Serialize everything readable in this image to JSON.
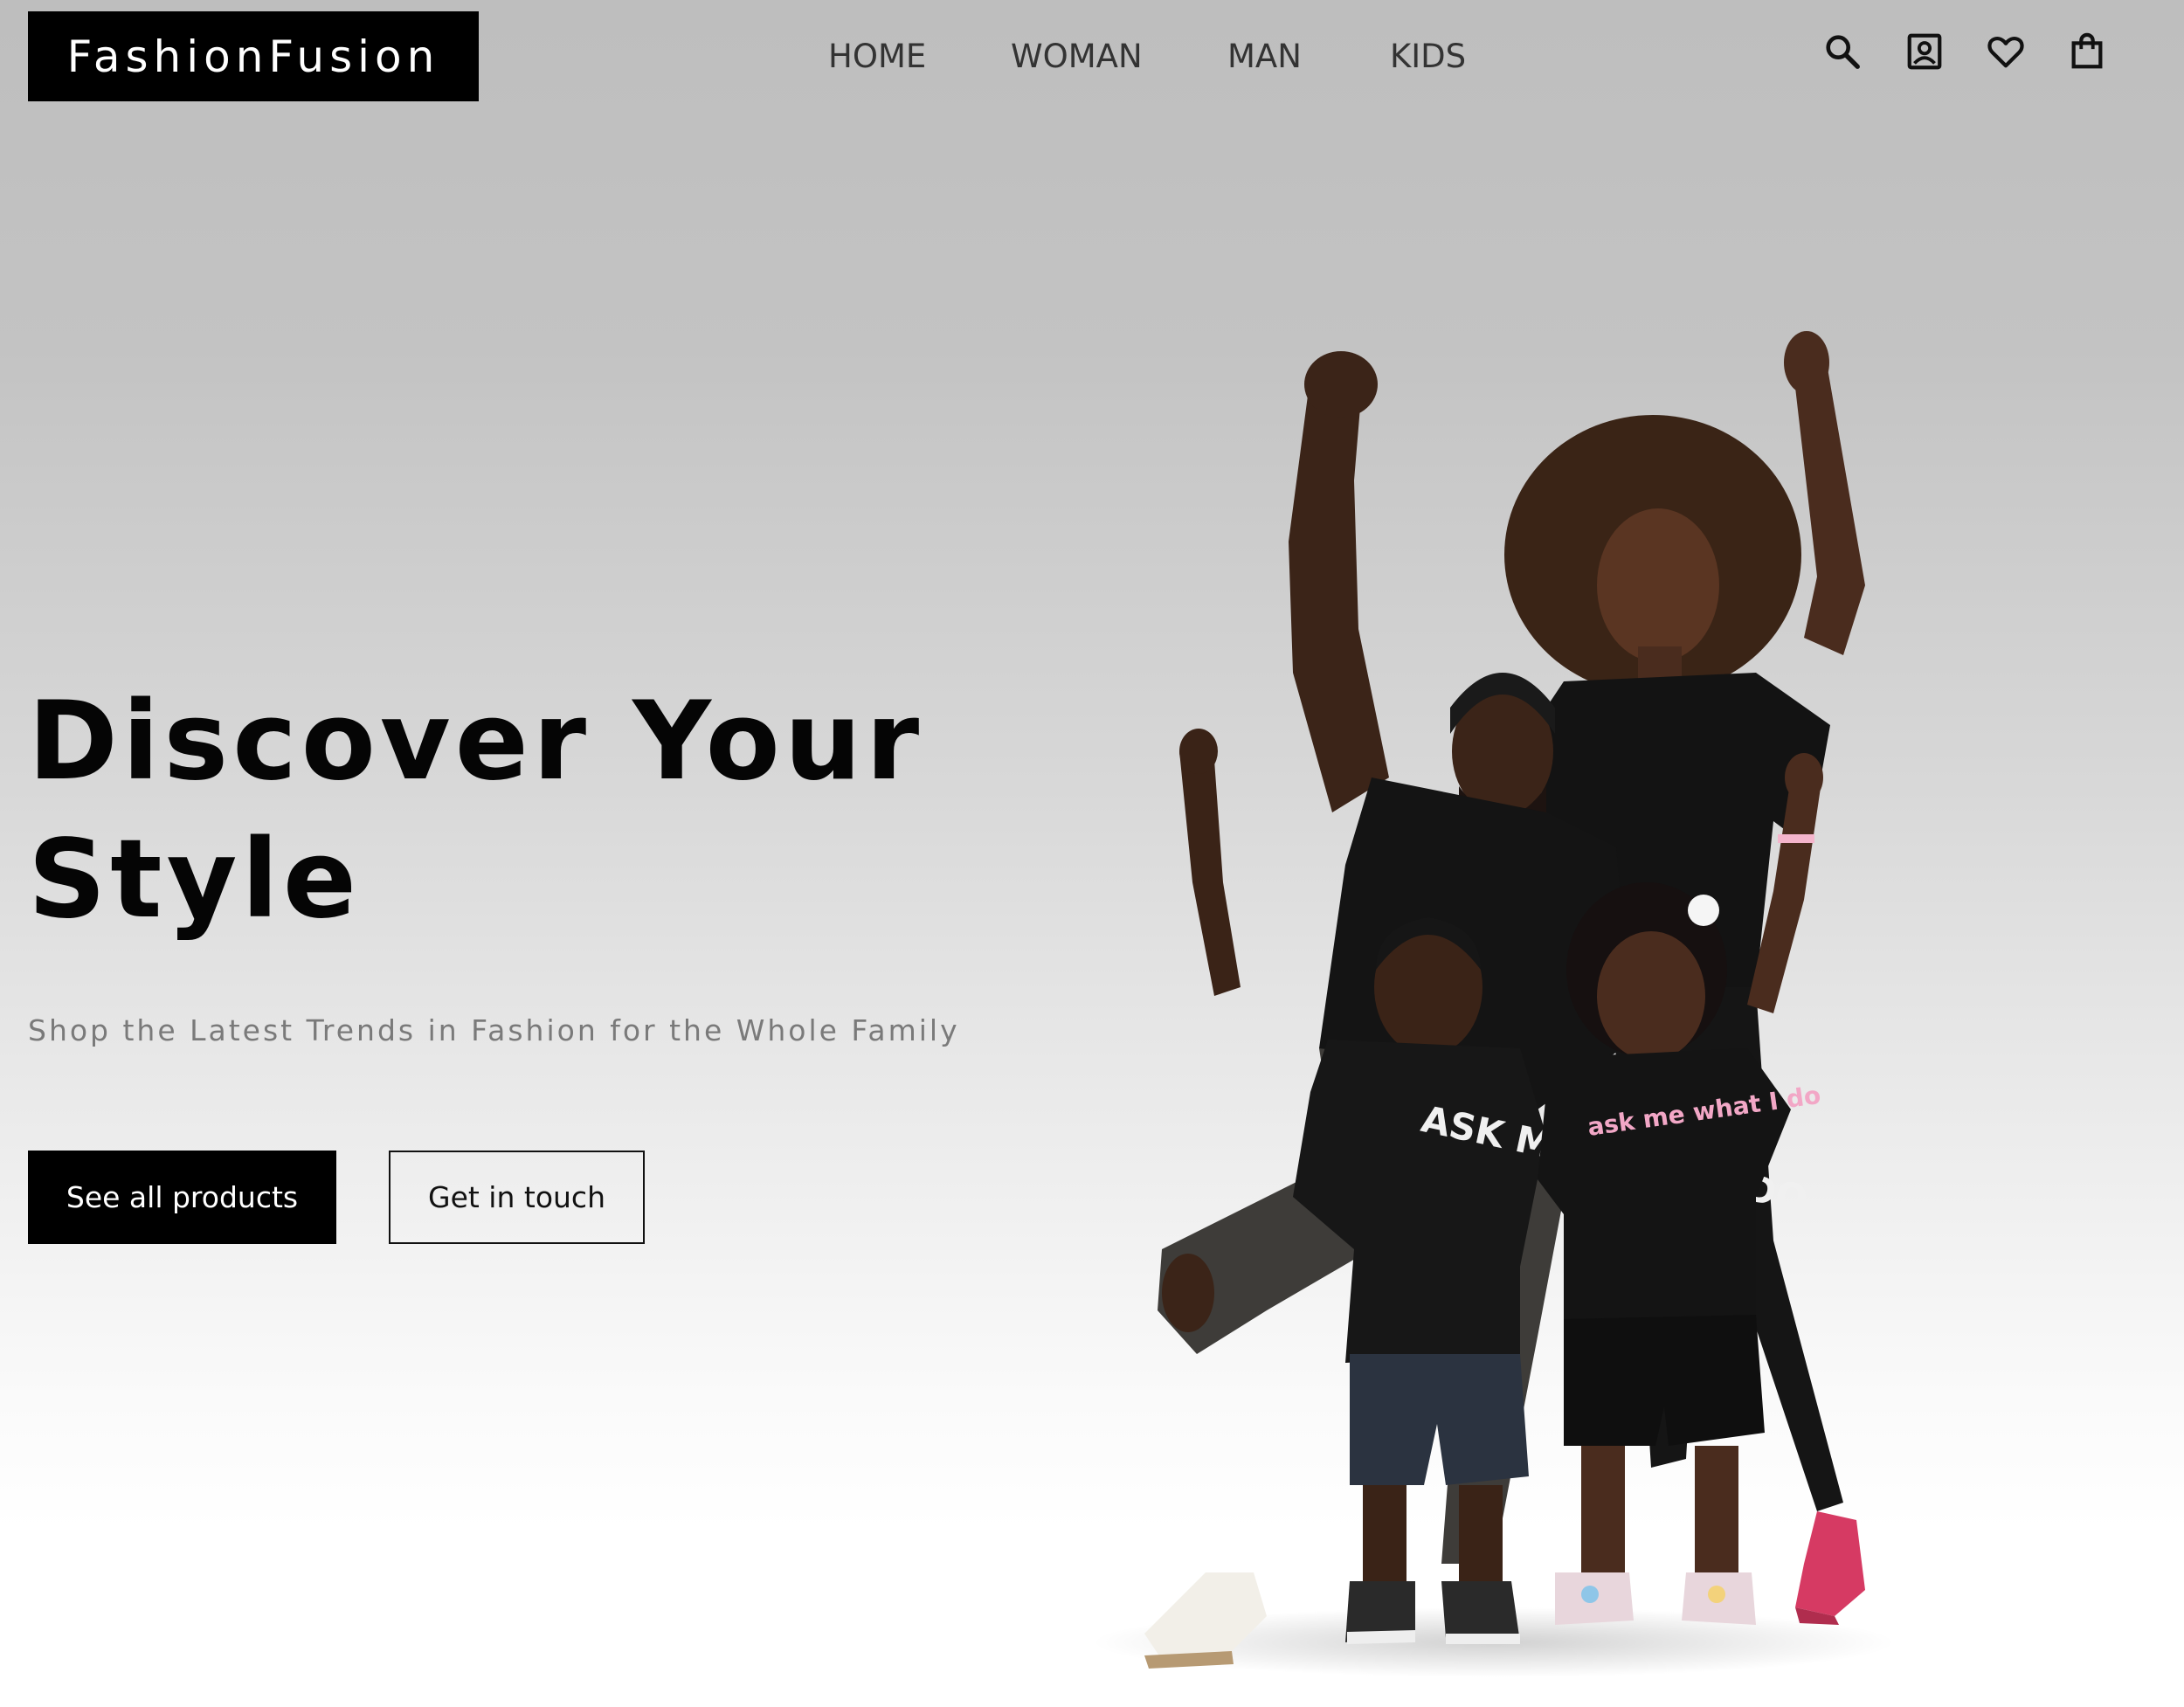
{
  "brand": {
    "logo_text": "FashionFusion"
  },
  "nav": {
    "items": [
      "HOME",
      "WOMAN",
      "MAN",
      "KIDS"
    ]
  },
  "header_icons": [
    "search-icon",
    "account-icon",
    "heart-icon",
    "shopping-bag-icon"
  ],
  "hero": {
    "title_line1": "Discover Your",
    "title_line2": "Style",
    "subtitle": "Shop the Latest Trends in Fashion for the Whole Family",
    "primary_button": "See all products",
    "secondary_button": "Get in touch",
    "image": {
      "shirt_text_boy": "ASK ME WHAT I DO",
      "shirt_text_girl": "ask me what I do"
    }
  },
  "colors": {
    "brand": "#000000",
    "background_top": "#bebebe",
    "background_bottom": "#ffffff",
    "subtitle": "#7a7a7a"
  }
}
